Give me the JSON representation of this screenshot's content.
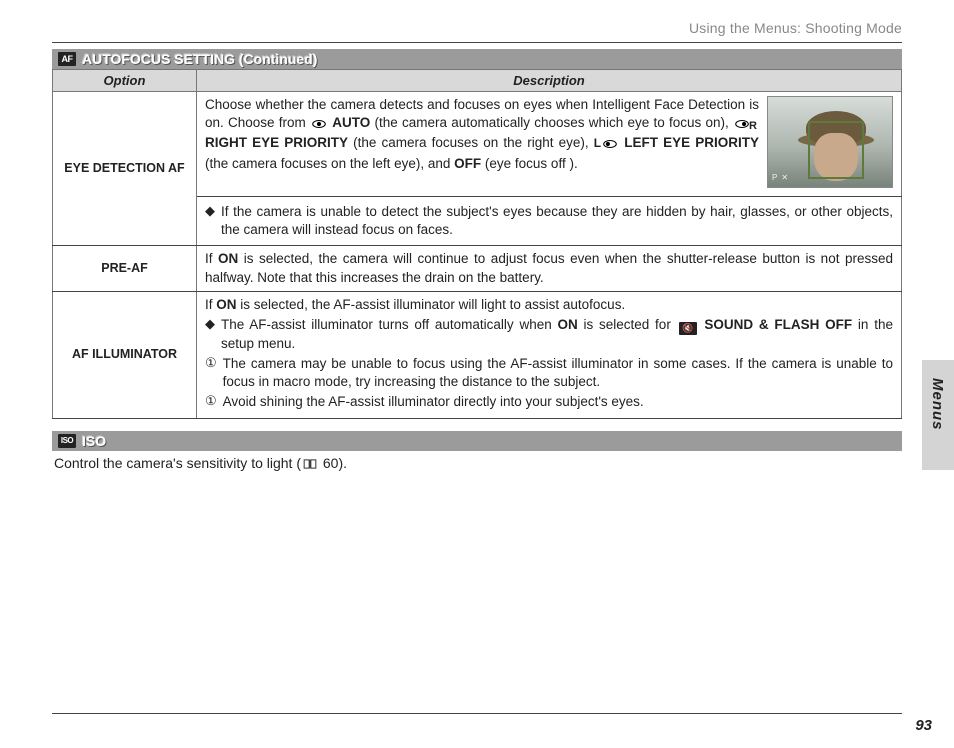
{
  "breadcrumb": "Using the Menus: Shooting Mode",
  "section1": {
    "icon": "AF",
    "title": "AUTOFOCUS SETTING (Continued)"
  },
  "table": {
    "headers": {
      "option": "Option",
      "description": "Description"
    },
    "rows": {
      "eyedet": {
        "option": "EYE DETECTION AF",
        "desc_parts": {
          "p1": "Choose whether the camera detects and focuses on eyes when Intelligent Face Detection is on.  Choose from ",
          "auto": "AUTO",
          "p2": " (the camera automatically chooses which eye to focus on), ",
          "right": "RIGHT EYE PRIORITY",
          "p3": " (the camera focuses on the right eye), ",
          "left": "LEFT EYE PRIORITY",
          "p4": " (the camera focuses on the left eye), and ",
          "off": "OFF",
          "p5": " (eye focus off )."
        },
        "note": "If the camera is unable to detect the subject's eyes because they are hidden by hair, glasses, or other objects, the camera will instead focus on faces."
      },
      "preaf": {
        "option": "PRE-AF",
        "desc_pre": "If ",
        "on": "ON",
        "desc_post": " is selected, the camera will continue to adjust focus even when the shutter-release button is not pressed halfway.  Note that this increases the drain on the battery."
      },
      "afill": {
        "option": "AF ILLUMINATOR",
        "line_pre": "If ",
        "on": "ON",
        "line_post": " is selected, the AF-assist illuminator will light to assist autofocus.",
        "note1_pre": "The AF-assist illuminator turns off automatically when ",
        "note1_on": "ON",
        "note1_mid": " is selected for ",
        "note1_label": "SOUND & FLASH OFF",
        "note1_post": " in the setup menu.",
        "warn1": "The camera may be unable to focus using the AF-assist illuminator in some cases.  If the camera is unable to focus in macro mode, try increasing the distance to the subject.",
        "warn2": "Avoid shining the AF-assist illuminator directly into your subject's eyes."
      }
    }
  },
  "section2": {
    "icon": "ISO",
    "title": "ISO"
  },
  "iso_text_pre": "Control the camera's sensitivity to light (",
  "iso_page_ref": " 60).",
  "side_label": "Menus",
  "page_number": "93",
  "thumb_status": "P  ✕"
}
